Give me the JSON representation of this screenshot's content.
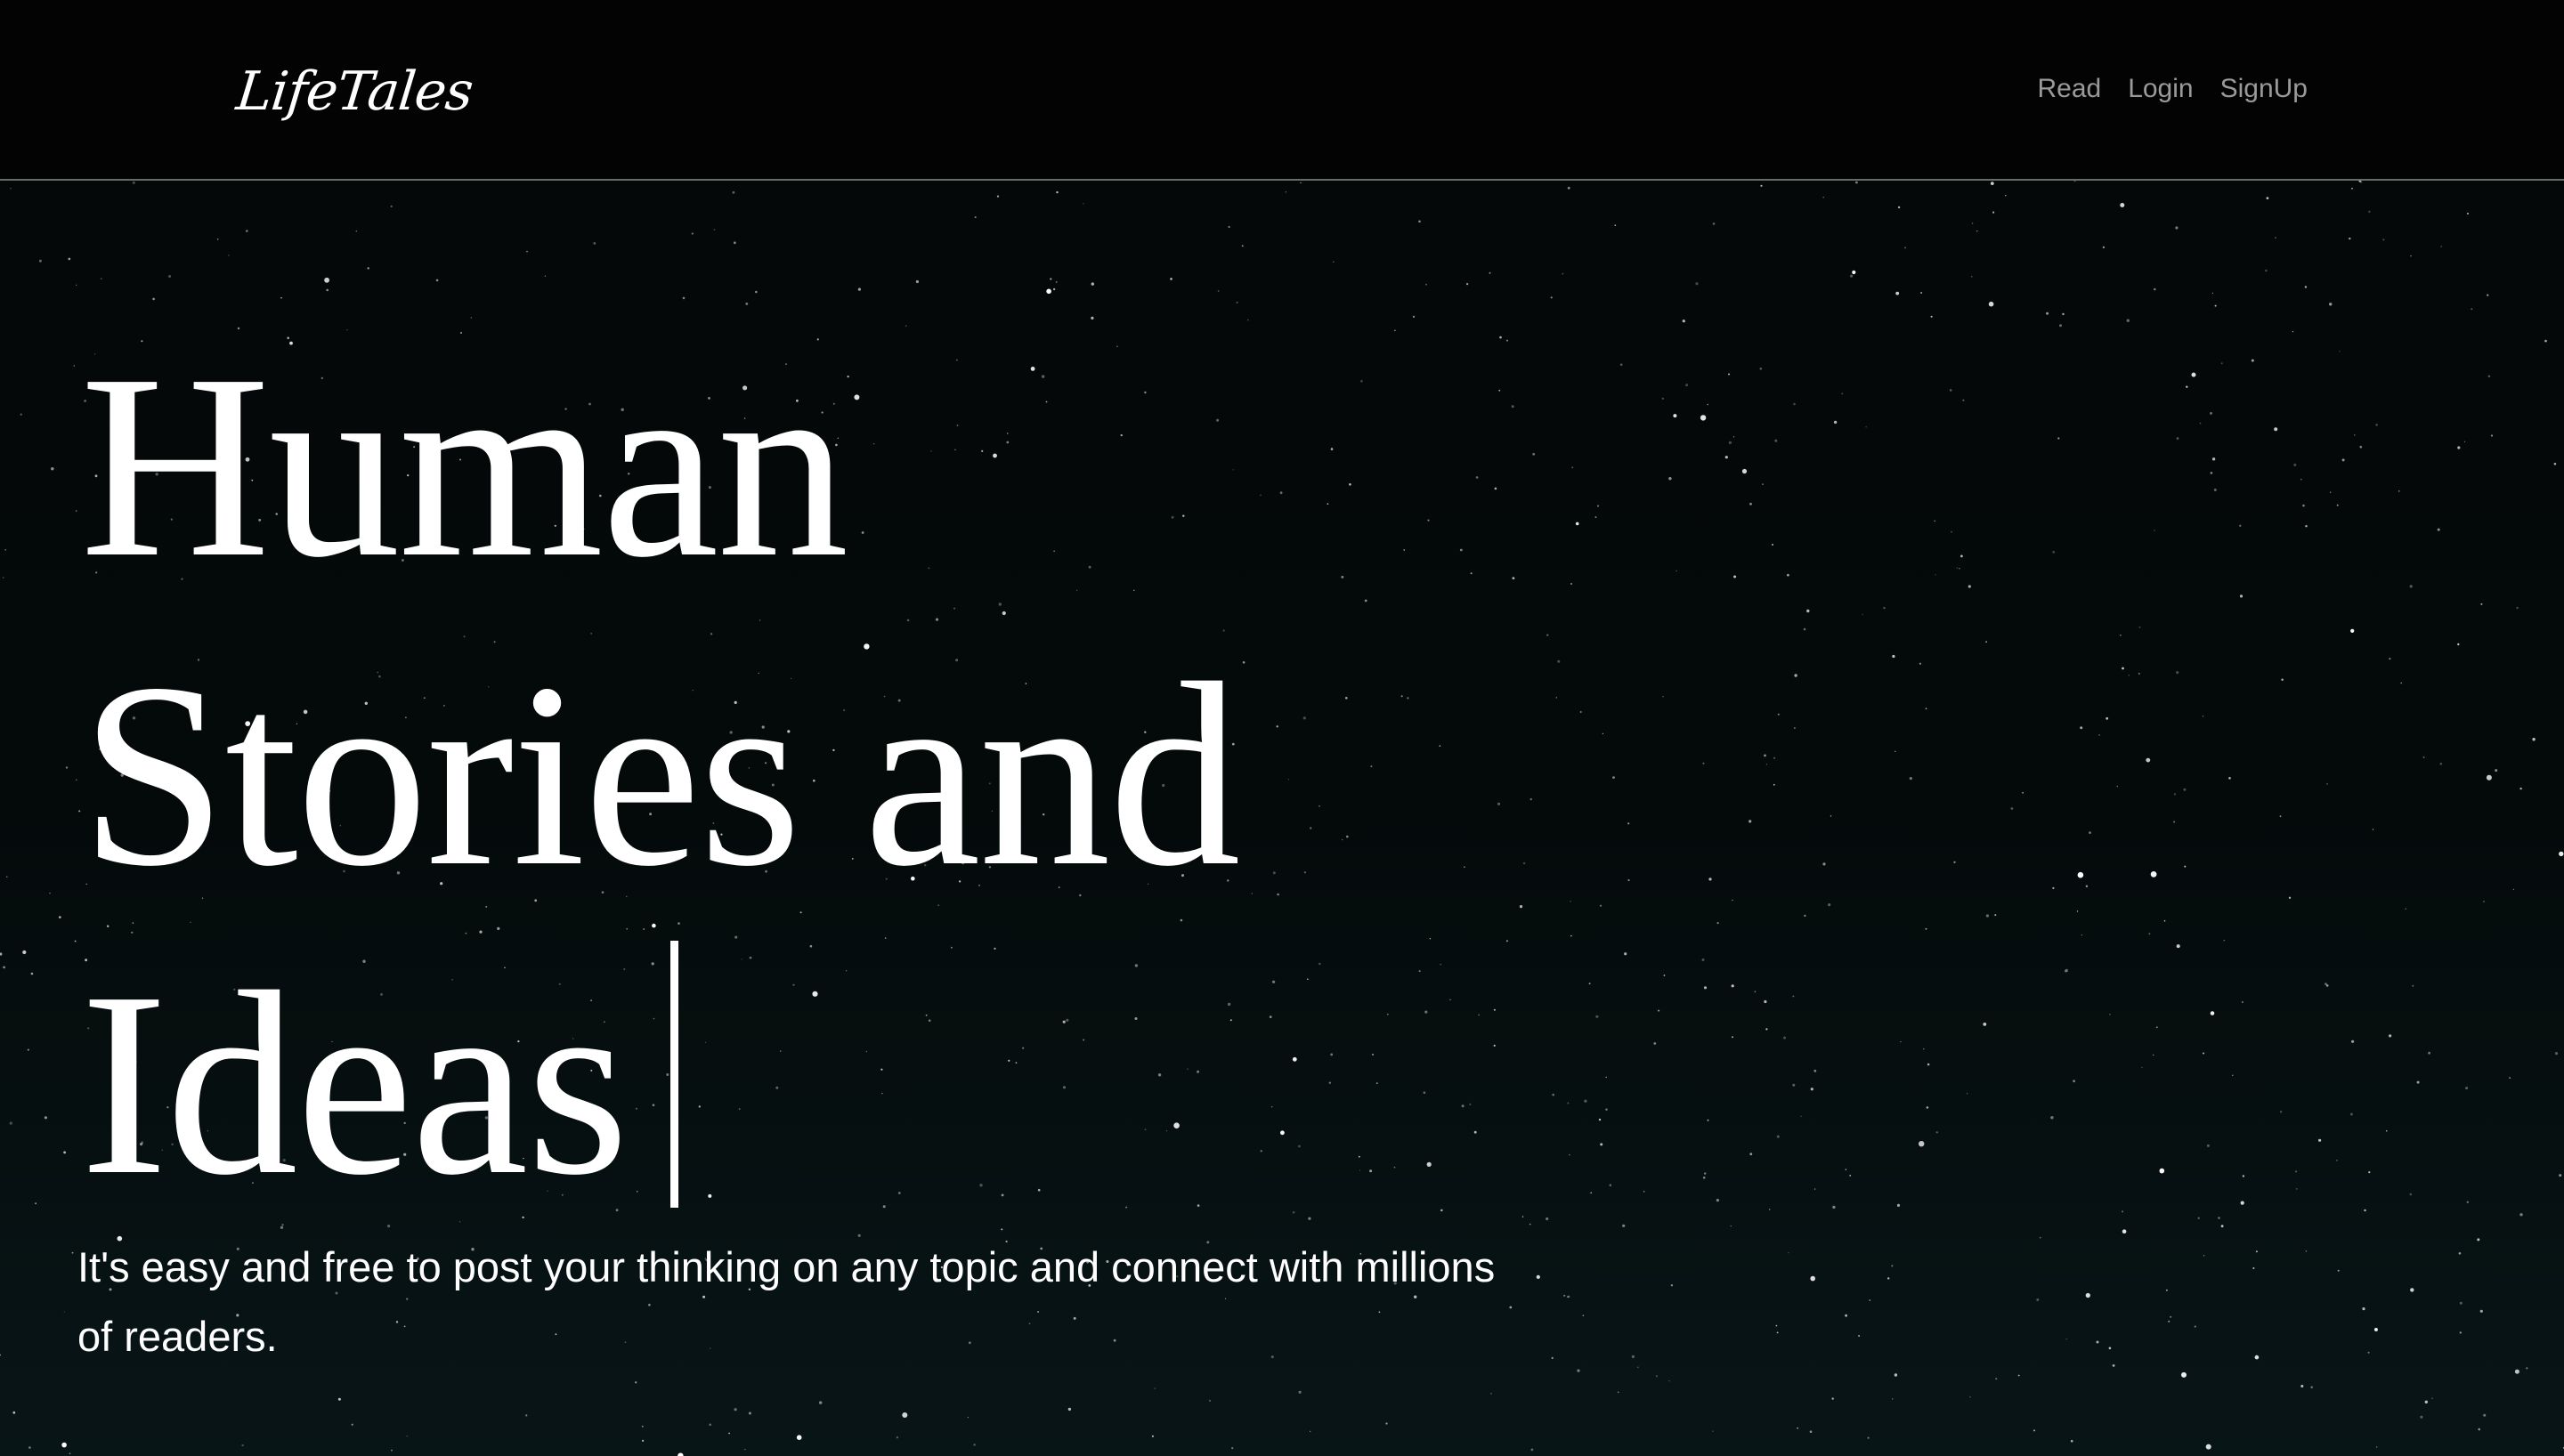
{
  "nav": {
    "brand": "LifeTales",
    "links": [
      "Read",
      "Login",
      "SignUp"
    ]
  },
  "hero": {
    "headline_lines": [
      "Human",
      "Stories and",
      "Ideas"
    ],
    "subtitle": "It's easy and free to post your thinking on any topic and connect with millions of readers."
  },
  "colors": {
    "nav_background": "#030303",
    "nav_link": "#9a9a9a",
    "hero_background": "#050808",
    "text": "#ffffff"
  }
}
